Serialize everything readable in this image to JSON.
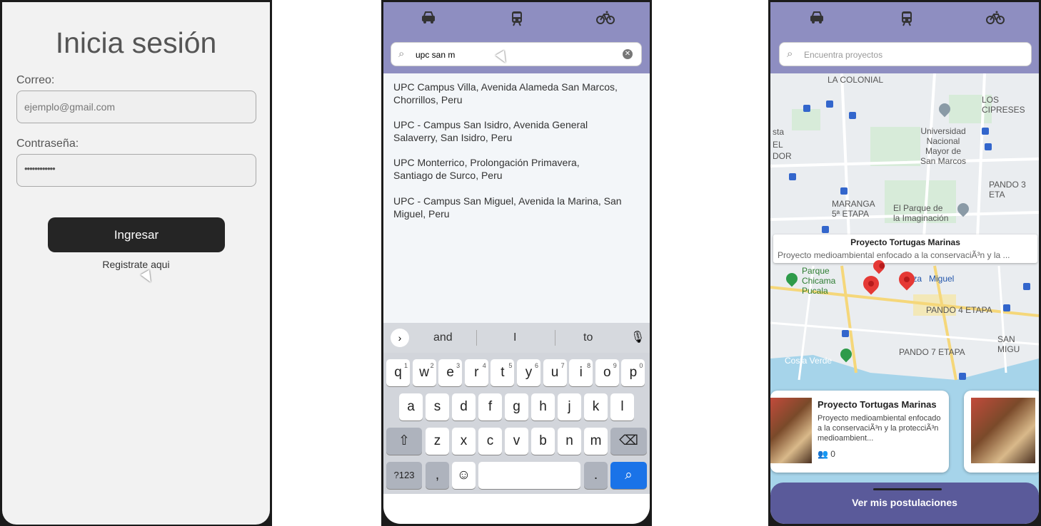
{
  "login": {
    "title": "Inicia sesión",
    "email_label": "Correo:",
    "email_placeholder": "ejemplo@gmail.com",
    "password_label": "Contraseña:",
    "password_value": "••••••••••••",
    "submit_label": "Ingresar",
    "register_link": "Registrate aqui"
  },
  "search_screen": {
    "tabs": [
      "car-icon",
      "train-icon",
      "bike-icon"
    ],
    "search_value": "upc san m",
    "results": [
      {
        "line1": "UPC Campus Villa, Avenida Alameda San Marcos,",
        "line2": "Chorrillos, Peru"
      },
      {
        "line1": "UPC - Campus San Isidro, Avenida General",
        "line2": "Salaverry, San Isidro, Peru"
      },
      {
        "line1": "UPC Monterrico, Prolongación Primavera,",
        "line2": "Santiago de Surco, Peru"
      },
      {
        "line1": "UPC - Campus San Miguel, Avenida la Marina, San",
        "line2": "Miguel, Peru"
      }
    ],
    "suggestions": [
      "and",
      "I",
      "to"
    ],
    "keyboard": {
      "row1": [
        "q",
        "w",
        "e",
        "r",
        "t",
        "y",
        "u",
        "i",
        "o",
        "p"
      ],
      "row1_sup": [
        "1",
        "2",
        "3",
        "4",
        "5",
        "6",
        "7",
        "8",
        "9",
        "0"
      ],
      "row2": [
        "a",
        "s",
        "d",
        "f",
        "g",
        "h",
        "j",
        "k",
        "l"
      ],
      "row3": [
        "z",
        "x",
        "c",
        "v",
        "b",
        "n",
        "m"
      ],
      "num_key": "?123",
      "comma_key": ",",
      "period_key": "."
    }
  },
  "map_screen": {
    "search_placeholder": "Encuentra proyectos",
    "map_labels": {
      "la_colonial": "LA COLONIAL",
      "los_cipreses": "LOS CIPRESES",
      "univ_1": "Universidad",
      "univ_2": "Nacional",
      "univ_3": "Mayor de",
      "univ_4": "San Marcos",
      "pando3": "PANDO 3 ETA",
      "maranga_1": "MARANGA",
      "maranga_2": "5ª ETAPA",
      "parque_1": "El Parque de",
      "parque_2": "la Imaginación",
      "chicama_1": "Parque",
      "chicama_2": "Chicama",
      "chicama_3": "Pucala",
      "plaza": "Plaza",
      "miguel": "Miguel",
      "pando4": "PANDO 4 ETAPA",
      "pando7": "PANDO 7 ETAPA",
      "san_mig": "SAN MIGU",
      "costa_verde": "Costa Verde",
      "sta": "sta",
      "el": "EL",
      "dor": "DOR"
    },
    "popup": {
      "title": "Proyecto Tortugas Marinas",
      "desc": "Proyecto medioambiental enfocado a la conservaciÃ³n y la ..."
    },
    "card": {
      "title": "Proyecto Tortugas Marinas",
      "desc": "Proyecto medioambiental enfocado a la conservaciÃ³n y la protecciÃ³n medioambient...",
      "members": "0"
    },
    "bottom_button": "Ver mis postulaciones"
  }
}
